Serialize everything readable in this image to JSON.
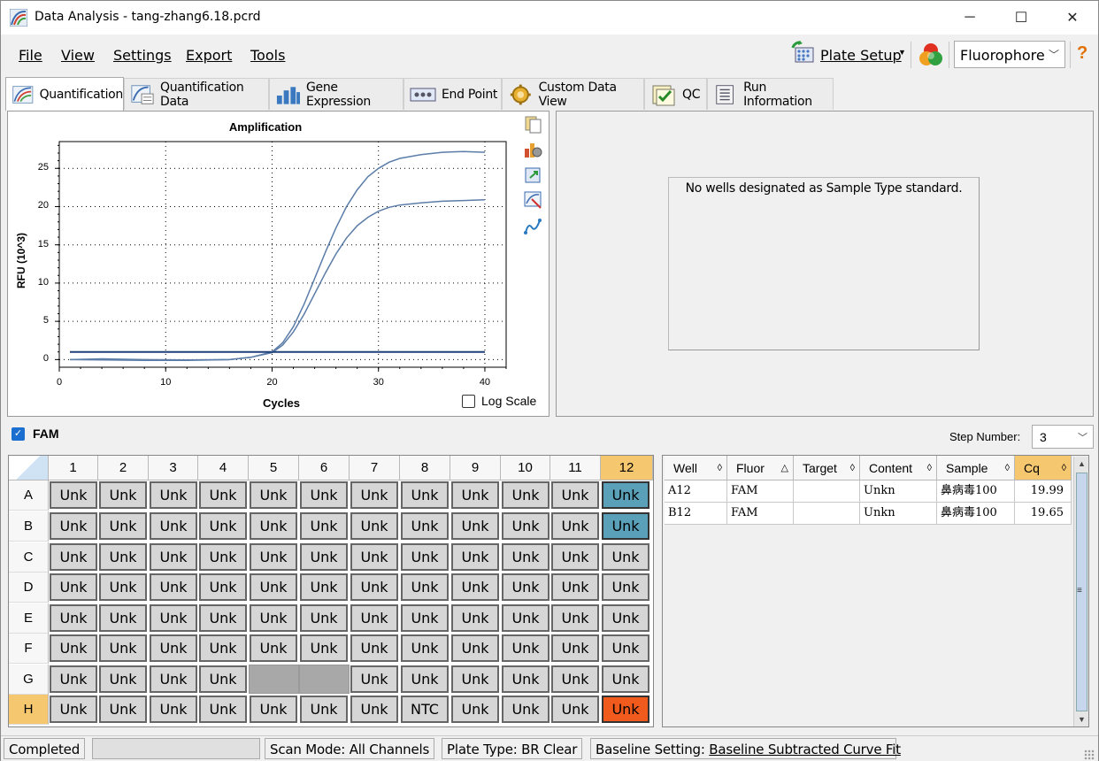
{
  "window": {
    "title": "Data Analysis - tang-zhang6.18.pcrd",
    "minimize": "─",
    "maximize": "☐",
    "close": "✕"
  },
  "menu": {
    "file": "File",
    "view": "View",
    "settings": "Settings",
    "export": "Export",
    "tools": "Tools"
  },
  "toolbar": {
    "plate_setup": "Plate Setup",
    "fluorophore": "Fluorophore",
    "help": "?"
  },
  "tabs": [
    {
      "label": "Quantification",
      "icon": "quantification-icon",
      "active": true
    },
    {
      "label": "Quantification Data",
      "icon": "quantification-data-icon",
      "active": false
    },
    {
      "label": "Gene Expression",
      "icon": "gene-expression-icon",
      "active": false
    },
    {
      "label": "End Point",
      "icon": "end-point-icon",
      "active": false
    },
    {
      "label": "Custom Data View",
      "icon": "custom-data-view-icon",
      "active": false
    },
    {
      "label": "QC",
      "icon": "qc-icon",
      "active": false
    },
    {
      "label": "Run Information",
      "icon": "run-information-icon",
      "active": false
    }
  ],
  "chart": {
    "log_scale_label": "Log Scale",
    "log_scale_checked": false,
    "tools": [
      "copy-icon",
      "chart-settings-icon",
      "export-icon",
      "zoom-icon",
      "trace-icon"
    ]
  },
  "chart_data": {
    "type": "line",
    "title": "Amplification",
    "xlabel": "Cycles",
    "ylabel": "RFU (10^3)",
    "xlim": [
      0,
      42
    ],
    "ylim": [
      -1,
      28.5
    ],
    "xticks": [
      0,
      10,
      20,
      30,
      40
    ],
    "yticks": [
      0,
      5,
      10,
      15,
      20,
      25
    ],
    "grid": true,
    "series": [
      {
        "x": [
          1,
          4,
          8,
          12,
          16,
          18,
          20,
          21,
          22,
          23,
          24,
          25,
          26,
          27,
          28,
          29,
          30,
          31,
          32,
          34,
          36,
          38,
          40
        ],
        "y": [
          0,
          -0.05,
          -0.1,
          -0.1,
          0,
          0.3,
          1,
          2.2,
          4.3,
          7.2,
          10.6,
          14,
          17.2,
          20,
          22.2,
          23.9,
          25,
          25.8,
          26.3,
          26.8,
          27.1,
          27.2,
          27.1
        ],
        "color": "#5b7da8"
      },
      {
        "x": [
          1,
          4,
          8,
          12,
          16,
          18,
          20,
          21,
          22,
          23,
          24,
          25,
          26,
          27,
          28,
          29,
          30,
          31,
          32,
          34,
          36,
          38,
          40
        ],
        "y": [
          0,
          0.1,
          0,
          -0.05,
          0,
          0.3,
          0.9,
          1.9,
          3.6,
          5.9,
          8.6,
          11.3,
          13.8,
          15.9,
          17.5,
          18.6,
          19.4,
          19.9,
          20.2,
          20.5,
          20.7,
          20.8,
          20.9
        ],
        "color": "#5b7da8"
      },
      {
        "x": [
          1,
          40
        ],
        "y": [
          1,
          1
        ],
        "color": "#1f3f78"
      }
    ]
  },
  "standard_curve": {
    "message": "No wells designated as Sample Type standard."
  },
  "fam": {
    "label": "FAM",
    "checked": true,
    "step_label": "Step Number:",
    "step_value": "3"
  },
  "plate": {
    "columns": [
      "1",
      "2",
      "3",
      "4",
      "5",
      "6",
      "7",
      "8",
      "9",
      "10",
      "11",
      "12"
    ],
    "rows": [
      "A",
      "B",
      "C",
      "D",
      "E",
      "F",
      "G",
      "H"
    ],
    "highlight_column": "12",
    "highlight_row": "H",
    "wells": [
      [
        "Unk",
        "Unk",
        "Unk",
        "Unk",
        "Unk",
        "Unk",
        "Unk",
        "Unk",
        "Unk",
        "Unk",
        "Unk",
        "Unk"
      ],
      [
        "Unk",
        "Unk",
        "Unk",
        "Unk",
        "Unk",
        "Unk",
        "Unk",
        "Unk",
        "Unk",
        "Unk",
        "Unk",
        "Unk"
      ],
      [
        "Unk",
        "Unk",
        "Unk",
        "Unk",
        "Unk",
        "Unk",
        "Unk",
        "Unk",
        "Unk",
        "Unk",
        "Unk",
        "Unk"
      ],
      [
        "Unk",
        "Unk",
        "Unk",
        "Unk",
        "Unk",
        "Unk",
        "Unk",
        "Unk",
        "Unk",
        "Unk",
        "Unk",
        "Unk"
      ],
      [
        "Unk",
        "Unk",
        "Unk",
        "Unk",
        "Unk",
        "Unk",
        "Unk",
        "Unk",
        "Unk",
        "Unk",
        "Unk",
        "Unk"
      ],
      [
        "Unk",
        "Unk",
        "Unk",
        "Unk",
        "Unk",
        "Unk",
        "Unk",
        "Unk",
        "Unk",
        "Unk",
        "Unk",
        "Unk"
      ],
      [
        "Unk",
        "Unk",
        "Unk",
        "Unk",
        "",
        "",
        "Unk",
        "Unk",
        "Unk",
        "Unk",
        "Unk",
        "Unk"
      ],
      [
        "Unk",
        "Unk",
        "Unk",
        "Unk",
        "Unk",
        "Unk",
        "Unk",
        "NTC",
        "Unk",
        "Unk",
        "Unk",
        "Unk"
      ]
    ],
    "selected_wells": [
      "A12",
      "B12"
    ],
    "red_wells": [
      "H12"
    ],
    "colors": {
      "selected": "#5aa0b8",
      "red": "#f05a1c",
      "normal": "#d6d6d6",
      "empty": "#a8a8a8",
      "highlight": "#f5c76f"
    }
  },
  "results_table": {
    "headers": [
      "Well",
      "Fluor",
      "Target",
      "Content",
      "Sample",
      "Cq"
    ],
    "sort_icons": [
      "◊",
      "△",
      "◊",
      "◊",
      "◊",
      "◊"
    ],
    "rows": [
      [
        "A12",
        "FAM",
        "",
        "Unkn",
        "鼻病毒100",
        "19.99"
      ],
      [
        "B12",
        "FAM",
        "",
        "Unkn",
        "鼻病毒100",
        "19.65"
      ]
    ]
  },
  "status": {
    "state": "Completed",
    "progress": "",
    "scan_mode": "Scan Mode: All Channels",
    "plate_type": "Plate Type: BR Clear",
    "baseline_prefix": "Baseline Setting: ",
    "baseline_value": "Baseline Subtracted Curve Fit"
  }
}
